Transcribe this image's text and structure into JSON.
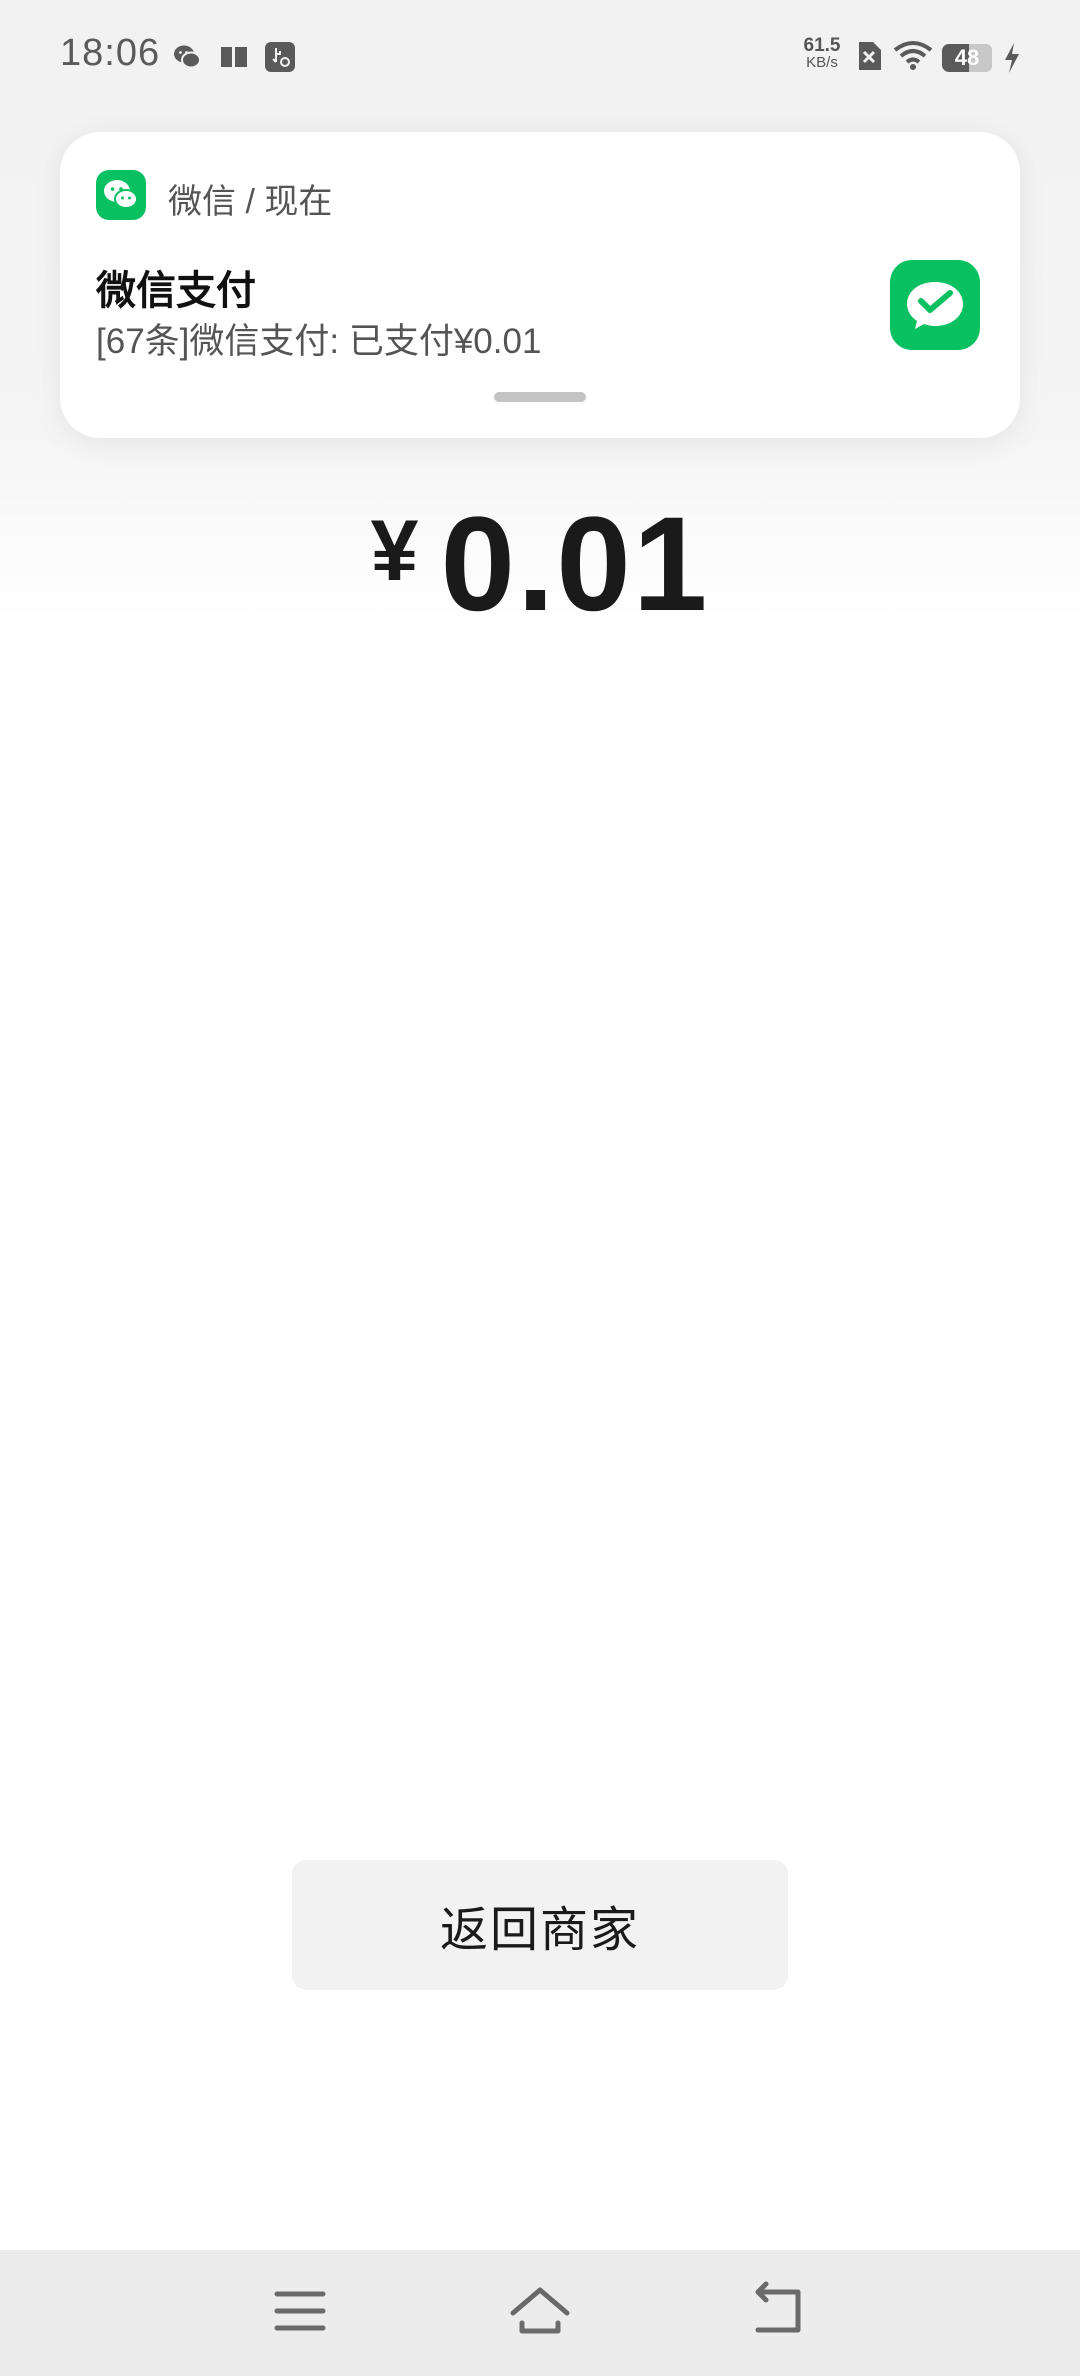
{
  "status_bar": {
    "time": "18:06",
    "left_icons": [
      "wechat-icon",
      "book-icon",
      "usb-debug-icon"
    ],
    "net_speed_value": "61.5",
    "net_speed_unit": "KB/s",
    "right_icons": [
      "sim-disabled-icon",
      "wifi-icon",
      "battery-icon",
      "charging-icon"
    ],
    "battery_level": "48"
  },
  "notification": {
    "app_name": "微信 / 现在",
    "title": "微信支付",
    "body": "[67条]微信支付: 已支付¥0.01",
    "app_icon": "wechat-icon",
    "thumbnail_icon": "wechat-pay-icon",
    "accent_color": "#09c160"
  },
  "payment": {
    "currency_symbol": "¥",
    "amount": "0.01"
  },
  "actions": {
    "return_label": "返回商家"
  },
  "nav_bar": {
    "buttons": [
      "menu-icon",
      "home-icon",
      "back-icon"
    ]
  }
}
